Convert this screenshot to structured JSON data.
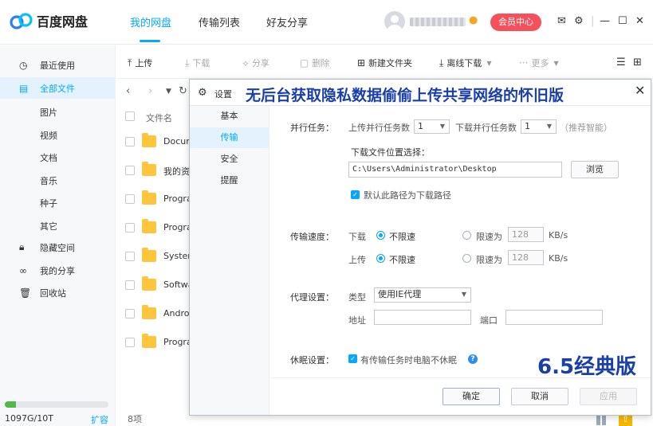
{
  "app": {
    "name": "百度网盘",
    "nav_tabs": [
      "我的网盘",
      "传输列表",
      "好友分享"
    ],
    "member_button": "会员中心",
    "colors": {
      "accent": "#06a7ff",
      "member_red": "#f4515d",
      "folder_yellow": "#ffc53d",
      "banner_blue": "#1a3fa8"
    }
  },
  "sidebar": {
    "items": [
      {
        "label": "最近使用",
        "icon": "clock-icon"
      },
      {
        "label": "全部文件",
        "icon": "file-icon"
      },
      {
        "label": "隐藏空间",
        "icon": "lock-icon"
      },
      {
        "label": "我的分享",
        "icon": "share-icon"
      },
      {
        "label": "回收站",
        "icon": "trash-icon"
      }
    ],
    "sub_items": [
      "图片",
      "视频",
      "文档",
      "音乐",
      "种子",
      "其它"
    ],
    "quota_text": "1097G/10T",
    "quota_fraction": 0.11,
    "expand_label": "扩容"
  },
  "toolbar": {
    "upload": "上传",
    "download": "下载",
    "share": "分享",
    "delete": "删除",
    "new_folder": "新建文件夹",
    "offline_download": "离线下载",
    "more": "更多"
  },
  "file_list": {
    "header": "文件名",
    "files": [
      "Docum",
      "我的资",
      "Progra",
      "Progra",
      "Syster",
      "Softwa",
      "Andro",
      "Progra"
    ],
    "count": "8项"
  },
  "dialog": {
    "title": "设置",
    "overlay_banner": "无后台获取隐私数据偷偷上传共享网络的怀旧版",
    "version_banner": "6.5经典版",
    "nav": [
      "基本",
      "传输",
      "安全",
      "提醒"
    ],
    "parallel": {
      "label": "并行任务：",
      "upload_label": "上传并行任务数",
      "upload_value": "1",
      "download_label": "下载并行任务数",
      "download_value": "1",
      "hint": "（推荐智能）"
    },
    "download_path": {
      "label": "下载文件位置选择：",
      "value": "C:\\Users\\Administrator\\Desktop",
      "browse": "浏览",
      "default_checkbox": "默认此路径为下载路径"
    },
    "speed": {
      "label": "传输速度：",
      "download": "下载",
      "upload": "上传",
      "unlimited": "不限速",
      "limit": "限速为",
      "down_limit_value": "128",
      "up_limit_value": "128",
      "unit": "KB/s"
    },
    "proxy": {
      "label": "代理设置：",
      "type_label": "类型",
      "type_value": "使用IE代理",
      "address_label": "地址",
      "port_label": "端口"
    },
    "sleep": {
      "label": "休眠设置：",
      "checkbox": "有传输任务时电脑不休眠"
    },
    "buttons": {
      "ok": "确定",
      "cancel": "取消",
      "apply": "应用"
    }
  }
}
